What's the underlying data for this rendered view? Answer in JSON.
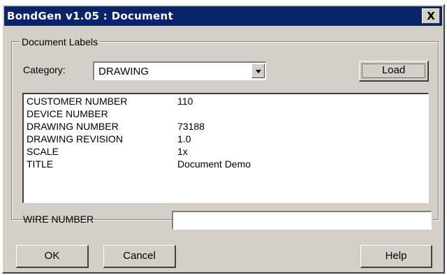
{
  "window": {
    "title": "BondGen v1.05 : Document",
    "close_label": "X"
  },
  "group": {
    "legend": "Document Labels"
  },
  "category": {
    "label": "Category:",
    "selected": "DRAWING"
  },
  "buttons": {
    "load": "Load",
    "ok": "OK",
    "cancel": "Cancel",
    "help": "Help"
  },
  "list": {
    "rows": [
      {
        "key": "CUSTOMER NUMBER",
        "value": "110"
      },
      {
        "key": "DEVICE NUMBER",
        "value": ""
      },
      {
        "key": "DRAWING NUMBER",
        "value": "73188"
      },
      {
        "key": "DRAWING REVISION",
        "value": "1.0"
      },
      {
        "key": "SCALE",
        "value": "1x"
      },
      {
        "key": "TITLE",
        "value": "Document Demo"
      }
    ]
  },
  "wire": {
    "label": "WIRE NUMBER",
    "value": ""
  },
  "icons": {
    "close": "close-icon",
    "dropdown": "chevron-down-icon"
  }
}
